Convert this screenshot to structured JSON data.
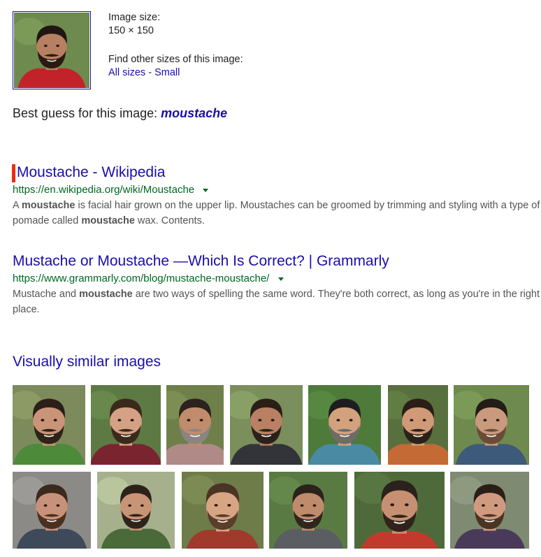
{
  "info": {
    "size_label": "Image size:",
    "size_value": "150 × 150",
    "find_label": "Find other sizes of this image:",
    "all_sizes": "All sizes",
    "separator": "-",
    "small": "Small"
  },
  "best_guess": {
    "label": "Best guess for this image:",
    "term": "moustache"
  },
  "results": [
    {
      "title": "Moustache - Wikipedia",
      "url": "https://en.wikipedia.org/wiki/Moustache",
      "snippet": [
        {
          "t": "A ",
          "b": false
        },
        {
          "t": "moustache",
          "b": true
        },
        {
          "t": " is facial hair grown on the upper lip. Moustaches can be groomed by trimming and styling with a type of pomade called ",
          "b": false
        },
        {
          "t": "moustache",
          "b": true
        },
        {
          "t": " wax. Contents.",
          "b": false
        }
      ]
    },
    {
      "title": "Mustache or Moustache —Which Is Correct? | Grammarly",
      "url": "https://www.grammarly.com/blog/mustache-moustache/",
      "snippet": [
        {
          "t": "Mustache and ",
          "b": false
        },
        {
          "t": "moustache",
          "b": true
        },
        {
          "t": " are two ways of spelling the same word. They're both correct, as long as you're in the right place.",
          "b": false
        }
      ]
    }
  ],
  "similar": {
    "title": "Visually similar images",
    "colors": {
      "link": "#1a0dab",
      "url": "#006621",
      "snippet": "#545454",
      "marker": "#ea2e14"
    },
    "tiles": [
      {
        "bg": "#7d8a5c",
        "skin": "#c99478",
        "hair": "#2b2018",
        "shirt": "#4d8a3a",
        "beard": "#2f2218"
      },
      {
        "bg": "#5d7a44",
        "skin": "#d4a184",
        "hair": "#3a2a1c",
        "shirt": "#7a2430",
        "beard": "#3b2a1c"
      },
      {
        "bg": "#6f7f4a",
        "skin": "#c18c6c",
        "hair": "#2a231e",
        "shirt": "#b08a86",
        "beard": "#8a8580"
      },
      {
        "bg": "#7a8f5c",
        "skin": "#b98063",
        "hair": "#2a1e17",
        "shirt": "#33343a",
        "beard": "#2b211a"
      },
      {
        "bg": "#4e7a3a",
        "skin": "#d2a27e",
        "hair": "#1e1e20",
        "shirt": "#4a8aa2",
        "beard": "#6f6b66"
      },
      {
        "bg": "#58703d",
        "skin": "#d09a78",
        "hair": "#2a1f18",
        "shirt": "#c46a34",
        "beard": "#2c2119"
      },
      {
        "bg": "#6f8a4e",
        "skin": "#c99a7e",
        "hair": "#241c16",
        "shirt": "#3e5a7a",
        "beard": "#6a4b37"
      },
      {
        "bg": "#8c8a86",
        "skin": "#c8927a",
        "hair": "#3a2a1e",
        "shirt": "#3e4a5a",
        "beard": "#4a3020"
      },
      {
        "bg": "#a6b08c",
        "skin": "#c89476",
        "hair": "#2a221b",
        "shirt": "#4a6a3a",
        "beard": "#2f241b"
      },
      {
        "bg": "#6e7c4a",
        "skin": "#d8a584",
        "hair": "#4a3424",
        "shirt": "#a03a2c",
        "beard": "#5a3e2a"
      },
      {
        "bg": "#5a7a44",
        "skin": "#c08a6c",
        "hair": "#2a221c",
        "shirt": "#5a5e62",
        "beard": "#2f261e"
      },
      {
        "bg": "#4f6a3a",
        "skin": "#c89072",
        "hair": "#2a221c",
        "shirt": "#c23a2e",
        "beard": "#2f241b"
      },
      {
        "bg": "#7f8a72",
        "skin": "#d09a80",
        "hair": "#2a1f18",
        "shirt": "#4a3a5a",
        "beard": "#4a3424"
      }
    ]
  },
  "main_thumb": {
    "bg": "#6e8a4e",
    "skin": "#b88062",
    "hair": "#1e1713",
    "shirt": "#c2222a",
    "beard": "#2a1a12"
  }
}
